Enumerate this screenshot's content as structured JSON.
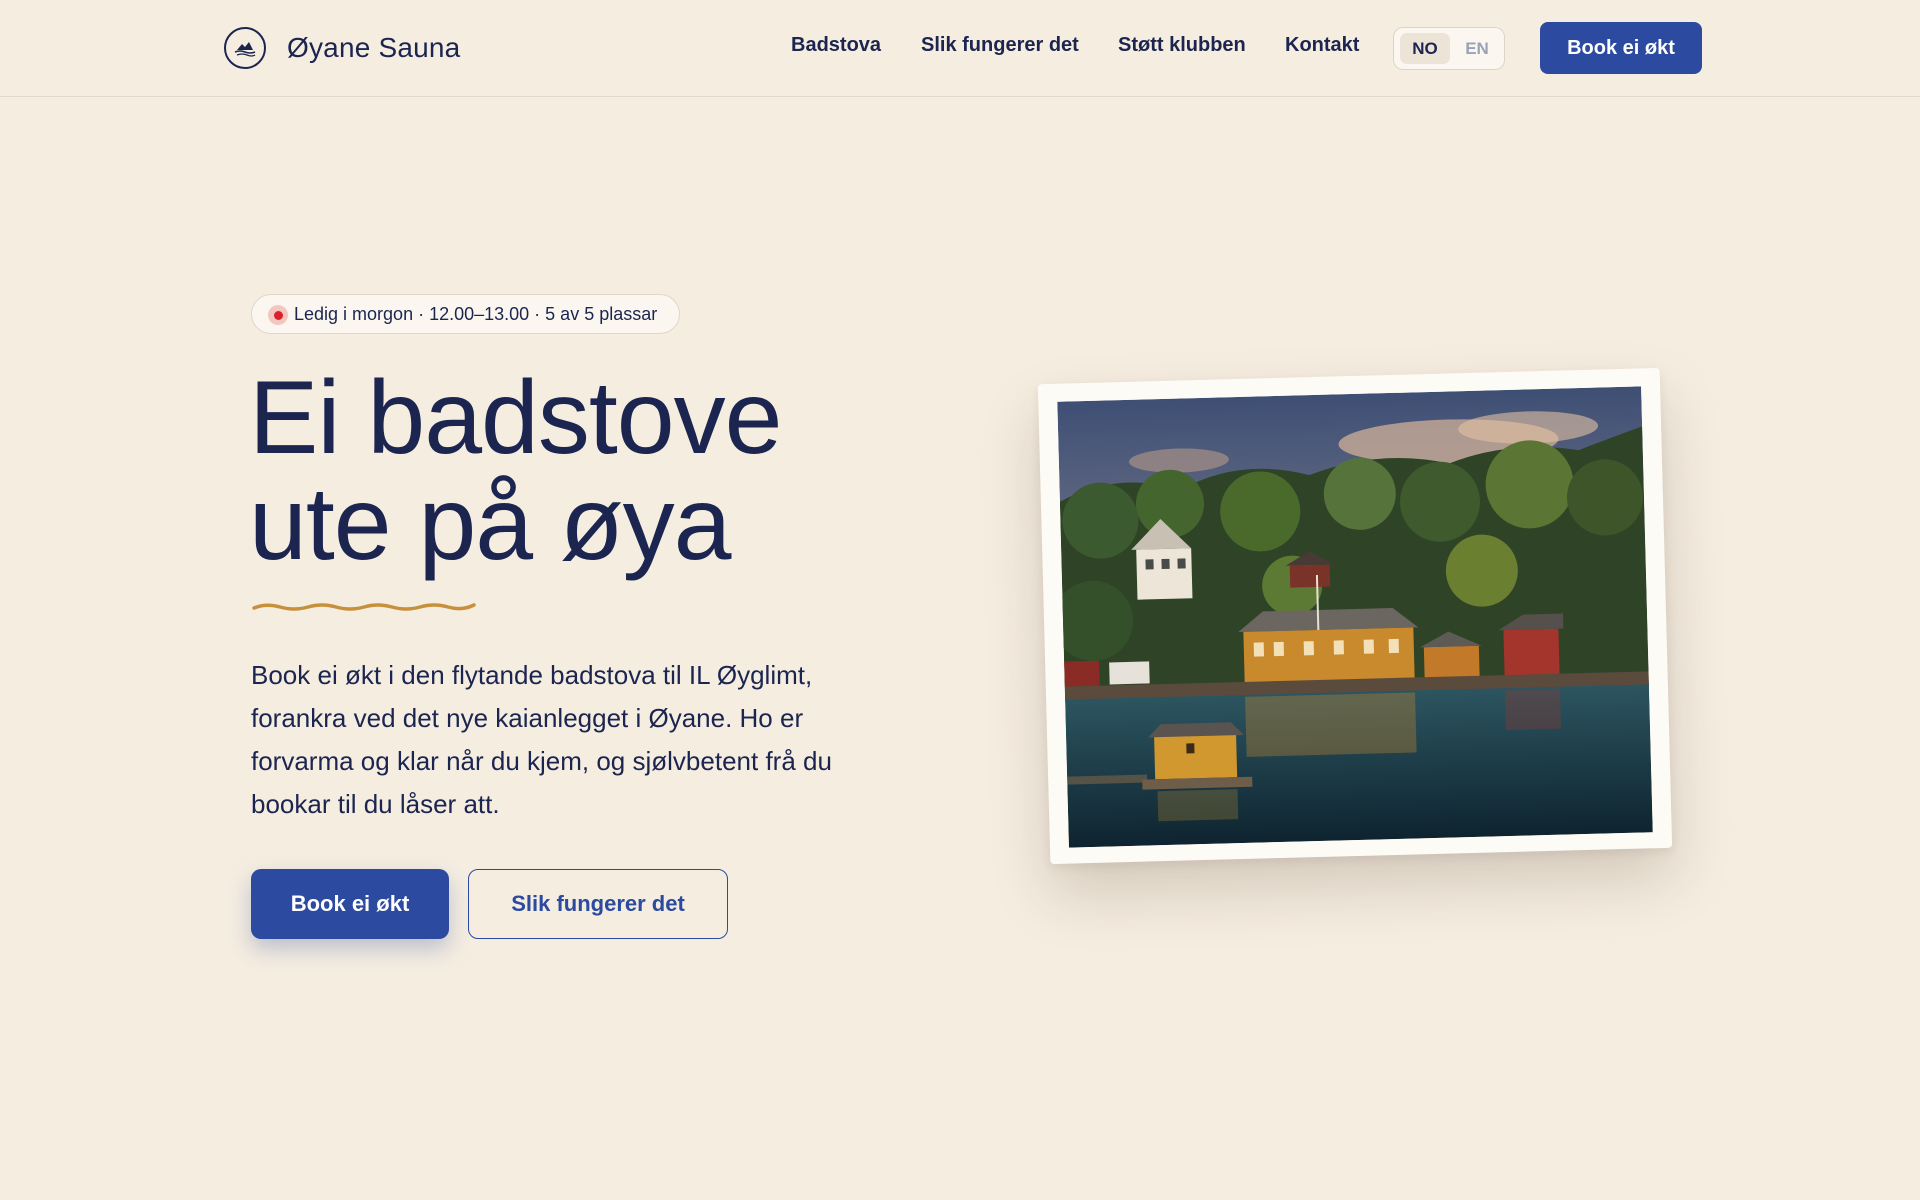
{
  "header": {
    "brand": "Øyane Sauna",
    "logo_icon": "sauna-boat-logo-icon",
    "nav": [
      "Badstova",
      "Slik fungerer det",
      "Støtt klubben",
      "Kontakt"
    ],
    "lang": {
      "active": "NO",
      "inactive": "EN"
    },
    "book_label": "Book ei økt"
  },
  "hero": {
    "availability": "Ledig i morgon · 12.00–13.00 · 5 av 5 plassar",
    "headline_line1": "Ei badstove",
    "headline_line2": "ute på øya",
    "lead": "Book ei økt i den flytande badstova til IL Øyglimt, forankra ved det nye kaianlegget i Øyane. Ho er forvarma og klar når du kjem, og sjølvbetent frå du bookar til du låser att.",
    "primary_cta": "Book ei økt",
    "secondary_cta": "Slik fungerer det"
  },
  "colors": {
    "background": "#f5ede0",
    "navy": "#1b2550",
    "accent_blue": "#2b4aa0",
    "squiggle": "#c8903a",
    "live_dot": "#d8232a"
  }
}
